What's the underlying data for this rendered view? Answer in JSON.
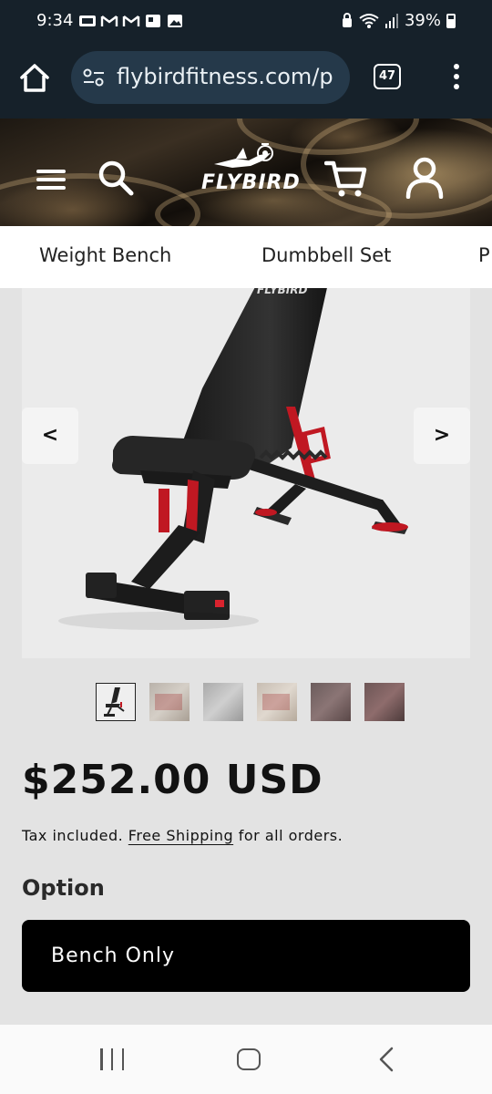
{
  "status_bar": {
    "time": "9:34",
    "notification_icons": [
      "gallery-icon",
      "gmail-icon",
      "gmail-icon",
      "photo-icon",
      "image-icon"
    ],
    "battery": "39%"
  },
  "browser": {
    "url": "flybirdfitness.com/p",
    "tab_count": "47"
  },
  "header": {
    "logo_text": "FLYBIRD"
  },
  "categories": [
    "Weight Bench",
    "Dumbbell Set",
    "P"
  ],
  "gallery": {
    "prev_label": "<",
    "next_label": ">",
    "image_brand_text": "FLYBIRD",
    "thumbnail_count": 6,
    "active_index": 0
  },
  "product": {
    "price": "$252.00 USD",
    "tax_prefix": "Tax included.",
    "shipping_link": "Free Shipping",
    "tax_suffix": "for all orders.",
    "option_label": "Option",
    "option_value": "Bench Only"
  },
  "colors": {
    "accent": "#d9232e",
    "browser_bg": "#16212a",
    "button_bg": "#000000"
  }
}
